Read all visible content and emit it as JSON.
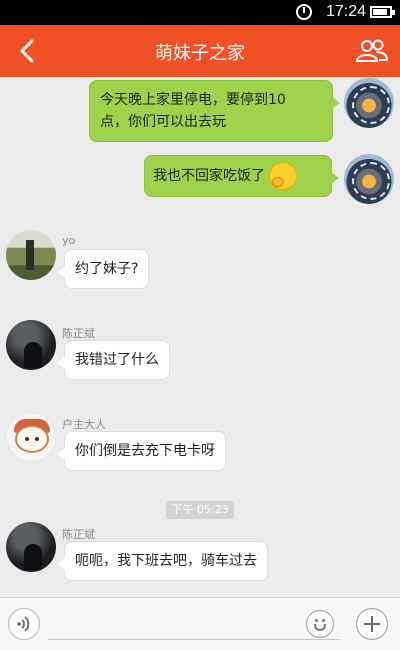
{
  "status_bar": {
    "time": "17:24",
    "icons": [
      "alarm-icon",
      "battery-icon"
    ],
    "battery_level": 0.85
  },
  "header": {
    "title": "萌妹子之家",
    "icons": [
      "back-arrow-icon",
      "group-members-icon"
    ],
    "color": "#ef5026"
  },
  "messages": [
    {
      "side": "me",
      "text_lines": [
        "今天晚上家里停电，要停到10",
        "点，你们可以出去玩"
      ]
    },
    {
      "side": "me",
      "text": "我也不回家吃饭了",
      "emoji": "shy-face-emoji"
    },
    {
      "side": "them",
      "sender": "yo",
      "text": "约了妹子?"
    },
    {
      "side": "them",
      "sender": "陈正斌",
      "text": "我错过了什么"
    },
    {
      "side": "them",
      "sender": "户主大人",
      "text": "你们倒是去充下电卡呀"
    },
    {
      "side": "them",
      "sender": "陈正斌",
      "text": "呃呃，我下班去吧，骑车过去"
    }
  ],
  "timestamp": "下午 05:23",
  "input_bar": {
    "icons": [
      "voice-icon",
      "emoji-icon",
      "plus-icon"
    ],
    "placeholder": ""
  },
  "colors": {
    "my_bubble": "#9ed24b",
    "their_bubble": "#ffffff",
    "background": "#ebebeb"
  }
}
